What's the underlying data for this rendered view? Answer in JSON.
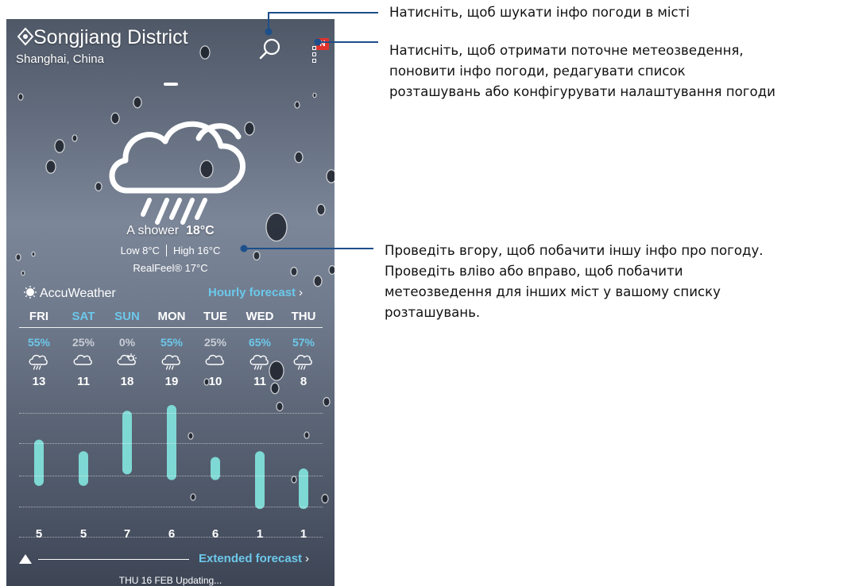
{
  "location": {
    "name": "Songjiang District",
    "region": "Shanghai, China"
  },
  "header": {
    "search_icon": "search-icon",
    "menu_icon": "more-options-icon",
    "badge": "N"
  },
  "current": {
    "icon": "rain-shower-cloud-icon",
    "condition": "A shower",
    "temperature": "18°C",
    "low": "Low 8°C",
    "high": "High 16°C",
    "realfeel": "RealFeel® 17°C"
  },
  "provider": {
    "name": "AccuWeather",
    "icon": "sun-logo-icon"
  },
  "links": {
    "hourly": "Hourly forecast",
    "extended": "Extended forecast",
    "chevron": "›"
  },
  "colors": {
    "accent": "#6cc8ea",
    "bar": "#7ed8d4",
    "badge": "#e0332d"
  },
  "forecast": [
    {
      "day": "FRI",
      "weekend": false,
      "precip": "55%",
      "precip_hi": true,
      "icon": "rain-cloud-icon",
      "high": "13",
      "low": "5"
    },
    {
      "day": "SAT",
      "weekend": true,
      "precip": "25%",
      "precip_hi": false,
      "icon": "cloud-icon",
      "high": "11",
      "low": "5"
    },
    {
      "day": "SUN",
      "weekend": true,
      "precip": "0%",
      "precip_hi": false,
      "icon": "partly-sunny-icon",
      "high": "18",
      "low": "7"
    },
    {
      "day": "MON",
      "weekend": false,
      "precip": "55%",
      "precip_hi": true,
      "icon": "rain-cloud-icon",
      "high": "19",
      "low": "6"
    },
    {
      "day": "TUE",
      "weekend": false,
      "precip": "25%",
      "precip_hi": false,
      "icon": "cloud-icon",
      "high": "10",
      "low": "6"
    },
    {
      "day": "WED",
      "weekend": false,
      "precip": "65%",
      "precip_hi": true,
      "icon": "rain-cloud-icon",
      "high": "11",
      "low": "1"
    },
    {
      "day": "THU",
      "weekend": false,
      "precip": "57%",
      "precip_hi": true,
      "icon": "rain-cloud-icon",
      "high": "8",
      "low": "1"
    }
  ],
  "status": "THU 16 FEB Updating...",
  "callouts": {
    "search": "Натисніть, щоб шукати інфо погоди в місті",
    "menu": [
      "Натисніть, щоб отримати поточне метеозведення,",
      "поновити інфо погоди, редагувати список",
      "розташувань або конфігурувати налаштування погоди"
    ],
    "swipe": [
      "Проведіть вгору, щоб побачити іншу інфо про погоду.",
      "Проведіть вліво або вправо, щоб побачити",
      "метеозведення для інших міст у вашому списку",
      "розташувань."
    ]
  }
}
